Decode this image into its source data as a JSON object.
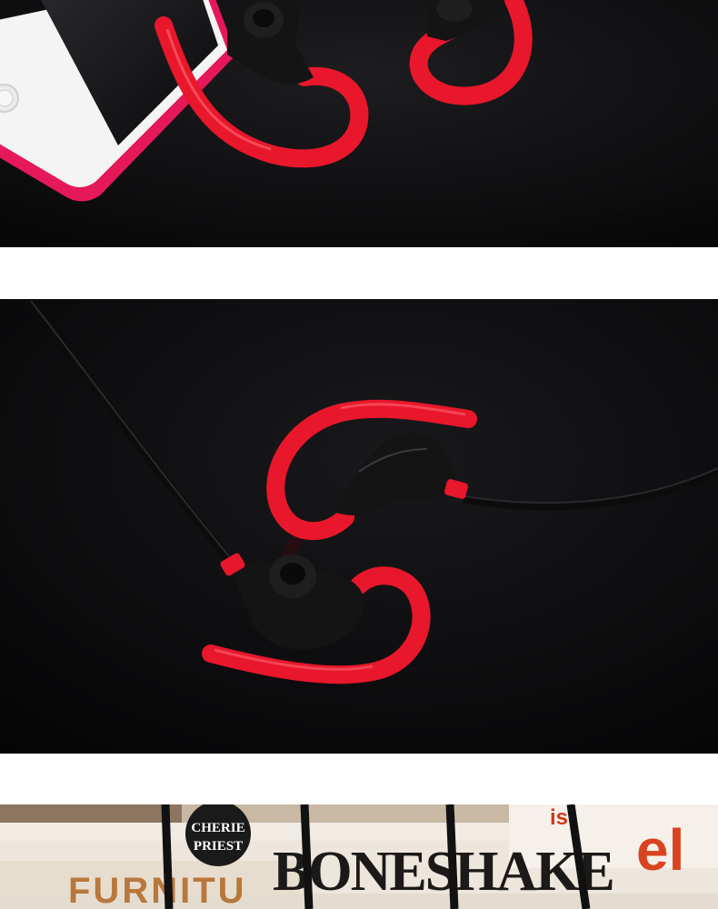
{
  "photos": [
    {
      "name": "earphones-with-phone-photo"
    },
    {
      "name": "earphones-pair-photo"
    },
    {
      "name": "earphones-on-books-photo"
    }
  ],
  "book_titles": {
    "round_badge_line1": "CHERIE",
    "round_badge_line2": "PRIEST",
    "spine_big": "BONESHAKE",
    "spine_left": "FURNITU",
    "spine_right_fragment": "el",
    "spine_right_small": "is!"
  },
  "colors": {
    "backdrop": "#0b0b0d",
    "hook_red": "#e8172b",
    "earbud_black": "#141414",
    "phone_white": "#f4f4f4",
    "phone_pink": "#e5195a"
  }
}
